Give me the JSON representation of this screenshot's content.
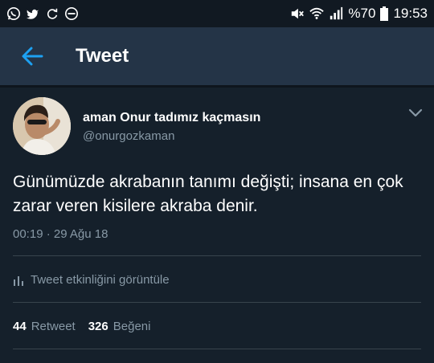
{
  "status_bar": {
    "icons_left": [
      "whatsapp-icon",
      "twitter-bird-icon",
      "sync-icon",
      "do-not-disturb-icon"
    ],
    "icons_right": [
      "mute-icon",
      "wifi-icon",
      "signal-icon"
    ],
    "battery": "%70",
    "time": "19:53"
  },
  "app_bar": {
    "back_icon": "back-arrow-icon",
    "title": "Tweet"
  },
  "tweet": {
    "author_name": "aman Onur tadımız kaçmasın",
    "author_handle": "@onurgozkaman",
    "text": "Günümüzde akrabanın tanımı değişti; insana en çok zarar veren kisilere akraba denir.",
    "timestamp": "00:19 · 29 Ağu 18",
    "activity_label": "Tweet etkinliğini görüntüle",
    "retweet_count": "44",
    "retweet_label": "Retweet",
    "like_count": "326",
    "like_label": "Beğeni"
  },
  "colors": {
    "background": "#15202b",
    "app_bar": "#243447",
    "accent": "#1da1f2",
    "secondary_text": "#8899a6",
    "divider": "#38444d"
  }
}
